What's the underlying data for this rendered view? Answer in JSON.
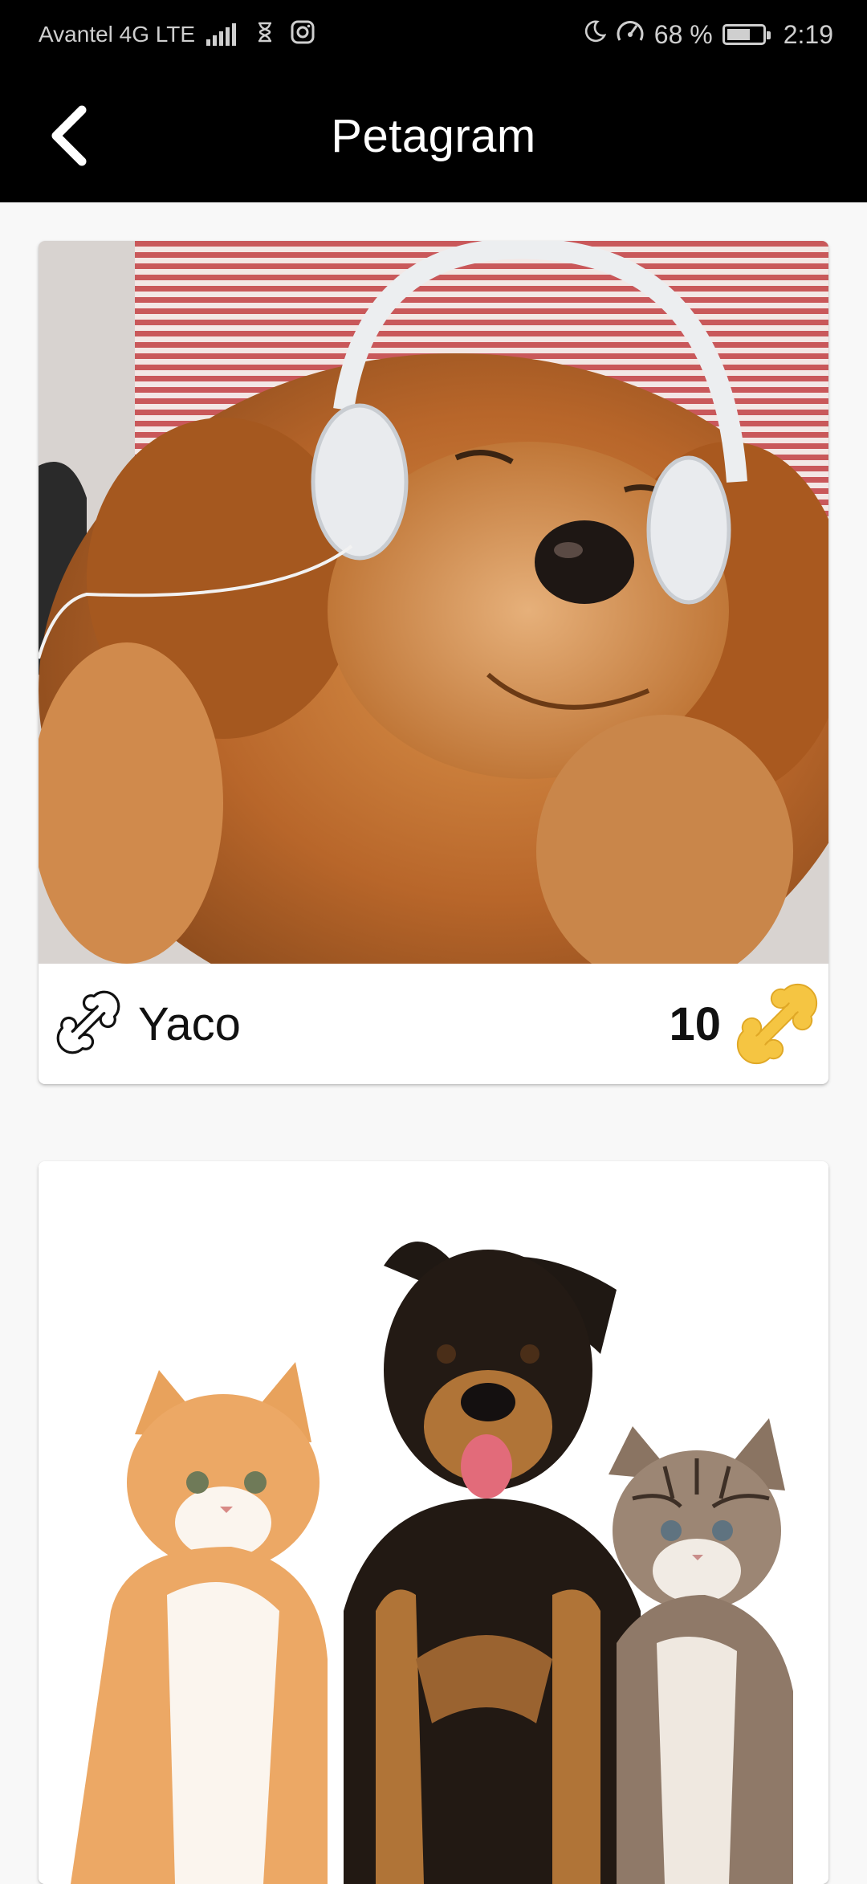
{
  "status_bar": {
    "carrier": "Avantel 4G LTE",
    "network_badge": "4G",
    "icons": [
      "signal-icon",
      "hourglass-icon",
      "instagram-icon",
      "moon-icon",
      "speedometer-icon",
      "battery-icon"
    ],
    "battery_percent": "68 %",
    "battery_level": 0.68,
    "time": "2:19"
  },
  "app_bar": {
    "title": "Petagram",
    "back_icon": "chevron-left-icon"
  },
  "pets": [
    {
      "name": "Yaco",
      "likes": "10",
      "photo": "golden retriever wearing headphones",
      "name_icon": "bone-outline-icon",
      "like_icon": "bone-filled-icon"
    },
    {
      "photo": "german shepherd puppy with two kittens"
    }
  ],
  "colors": {
    "app_bar": "#000000",
    "background": "#f8f8f8",
    "card": "#ffffff",
    "bone_filled": "#f5c542"
  }
}
